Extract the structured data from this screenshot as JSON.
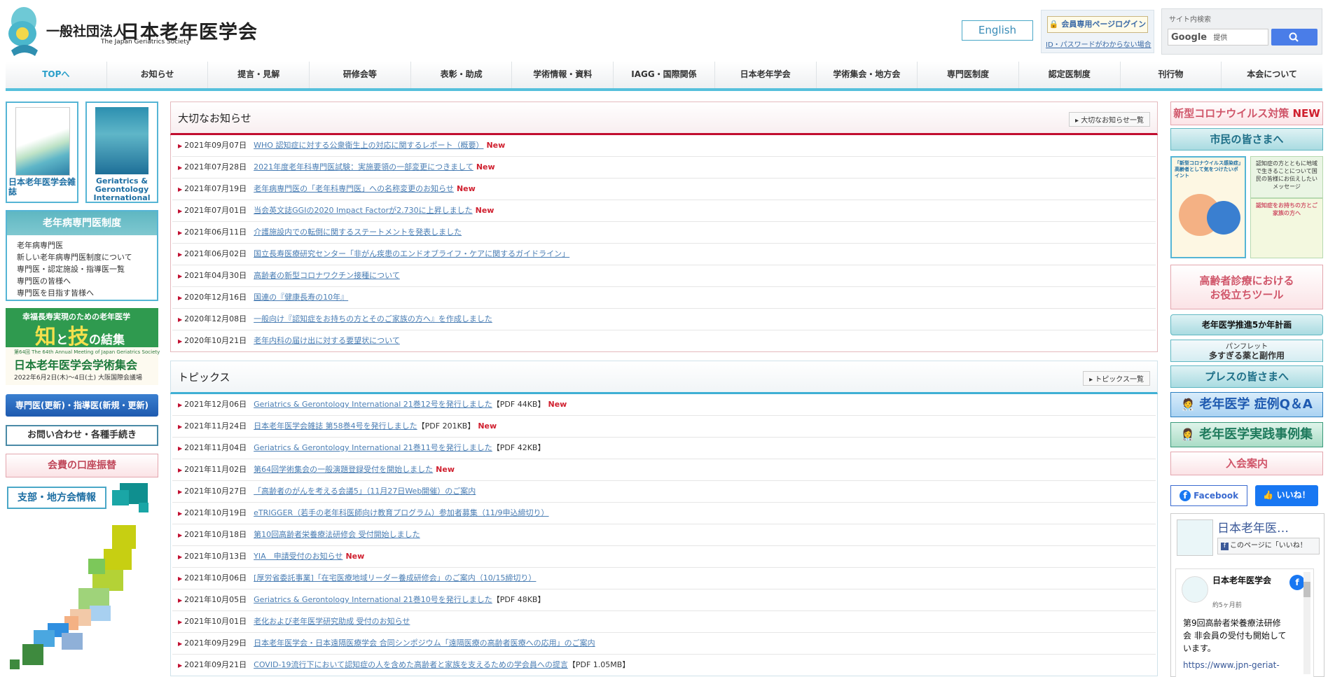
{
  "header": {
    "logo_small": "一般社団法人",
    "logo_large": "日本老年医学会",
    "logo_sub": "The Japan Geriatrics Society",
    "english": "English",
    "login": "会員専用ページログイン",
    "forgot": "ID・パスワードがわからない場合",
    "search_label": "サイト内検索",
    "search_brand": "Google",
    "search_placeholder": "提供"
  },
  "nav": [
    "TOPへ",
    "お知らせ",
    "提言・見解",
    "研修会等",
    "表彰・助成",
    "学術情報・資料",
    "IAGG・国際関係",
    "日本老年学会",
    "学術集会・地方会",
    "専門医制度",
    "認定医制度",
    "刊行物",
    "本会について"
  ],
  "left": {
    "book1": "日本老年医学会雑誌",
    "book2": "Geriatrics & Gerontology International",
    "geri_title": "老年病専門医制度",
    "geri_items": [
      "老年病専門医",
      "新しい老年病専門医制度について",
      "専門医・認定施設・指導医一覧",
      "専門医の皆様へ",
      "専門医を目指す皆様へ"
    ],
    "conf_top": "幸福長寿実現のための老年医学",
    "conf_big1": "知",
    "conf_mid": "と",
    "conf_big2": "技",
    "conf_tail": "の結集",
    "conf_sub": "第64回 The 64th Annual Meeting of Japan Geriatrics Society",
    "conf_title": "日本老年医学会学術集会",
    "conf_date": "2022年6月2日(木)～4日(土) 大阪国際会議場",
    "btn_specialist": "専門医(更新)・指導医(新規・更新)",
    "btn_contact": "お問い合わせ・各種手続き",
    "btn_fee": "会費の口座振替",
    "branch": "支部・地方会情報"
  },
  "important": {
    "title": "大切なお知らせ",
    "more": "大切なお知らせ一覧",
    "items": [
      {
        "date": "2021年09月07日",
        "text": "WHO 認知症に対する公衆衛生上の対応に関するレポート（概要）",
        "extra": "",
        "new": "New"
      },
      {
        "date": "2021年07月28日",
        "text": "2021年度老年科専門医試験：実施要領の一部変更につきまして",
        "extra": "",
        "new": "New"
      },
      {
        "date": "2021年07月19日",
        "text": "老年病専門医の「老年科専門医」への名称変更のお知らせ",
        "extra": "",
        "new": "New"
      },
      {
        "date": "2021年07月01日",
        "text": "当会英文誌GGIの2020 Impact Factorが2.730に上昇しました",
        "extra": "",
        "new": "New"
      },
      {
        "date": "2021年06月11日",
        "text": "介護施設内での転倒に関するステートメントを発表しました",
        "extra": "",
        "new": ""
      },
      {
        "date": "2021年06月02日",
        "text": "国立長寿医療研究センター「非がん疾患のエンドオブライフ・ケアに関するガイドライン」",
        "extra": "",
        "new": ""
      },
      {
        "date": "2021年04月30日",
        "text": "高齢者の新型コロナワクチン接種について",
        "extra": "",
        "new": ""
      },
      {
        "date": "2020年12月16日",
        "text": "国連の『健康長寿の10年』",
        "extra": "",
        "new": ""
      },
      {
        "date": "2020年12月08日",
        "text": "一般向け『認知症をお持ちの方とそのご家族の方へ』を作成しました",
        "extra": "",
        "new": ""
      },
      {
        "date": "2020年10月21日",
        "text": "老年内科の届け出に対する要望状について",
        "extra": "",
        "new": ""
      }
    ]
  },
  "topics": {
    "title": "トピックス",
    "more": "トピックス一覧",
    "items": [
      {
        "date": "2021年12月06日",
        "text": "Geriatrics & Gerontology International 21巻12号を発行しました",
        "extra": "【PDF 44KB】",
        "new": "New"
      },
      {
        "date": "2021年11月24日",
        "text": "日本老年医学会雑誌 第58巻4号を発行しました",
        "extra": "【PDF 201KB】",
        "new": "New"
      },
      {
        "date": "2021年11月04日",
        "text": "Geriatrics & Gerontology International 21巻11号を発行しました",
        "extra": "【PDF 42KB】",
        "new": ""
      },
      {
        "date": "2021年11月02日",
        "text": "第64回学術集会の一般演題登録受付を開始しました",
        "extra": "",
        "new": "New"
      },
      {
        "date": "2021年10月27日",
        "text": "「高齢者のがんを考える会議5」（11月27日Web開催）のご案内",
        "extra": "",
        "new": ""
      },
      {
        "date": "2021年10月19日",
        "text": "eTRIGGER（若手の老年科医師向け教育プログラム）参加者募集（11/9申込締切り）",
        "extra": "",
        "new": ""
      },
      {
        "date": "2021年10月18日",
        "text": "第10回高齢者栄養療法研修会 受付開始しました",
        "extra": "",
        "new": ""
      },
      {
        "date": "2021年10月13日",
        "text": "YIA　申請受付のお知らせ",
        "extra": "",
        "new": "New"
      },
      {
        "date": "2021年10月06日",
        "text": "[厚労省委託事業]「在宅医療地域リーダー養成研修会」のご案内（10/15締切り）",
        "extra": "",
        "new": ""
      },
      {
        "date": "2021年10月05日",
        "text": "Geriatrics & Gerontology International 21巻10号を発行しました",
        "extra": "【PDF 48KB】",
        "new": ""
      },
      {
        "date": "2021年10月01日",
        "text": "老化および老年医学研究助成 受付のお知らせ",
        "extra": "",
        "new": ""
      },
      {
        "date": "2021年09月29日",
        "text": "日本老年医学会・日本遠隔医療学会 合同シンポジウム「遠隔医療の高齢者医療への応用」のご案内",
        "extra": "",
        "new": ""
      },
      {
        "date": "2021年09月21日",
        "text": "COVID-19流行下において認知症の人を含めた高齢者と家族を支えるための学会員への提言",
        "extra": "【PDF 1.05MB】",
        "new": ""
      }
    ]
  },
  "right": {
    "covid": "新型コロナウイルス対策",
    "covid_new": "NEW",
    "citizens": "市民の皆さまへ",
    "thumb1": "「新型コロナウイルス感染症」高齢者として気をつけたいポイント",
    "thumb2": "認知症の方とともに地域で生きることについて国民の皆様にお伝えしたいメッセージ",
    "thumb3": "認知症をお持ちの方とご家族の方へ",
    "tools": "高齢者診療における\nお役立ちツール",
    "plan": "老年医学推進5か年計画",
    "pamphlet_top": "パンフレット",
    "pamphlet": "多すぎる薬と副作用",
    "press": "プレスの皆さまへ",
    "qa": "老年医学 症例Q＆A",
    "cases": "老年医学実践事例集",
    "join": "入会案内",
    "fb": "Facebook",
    "like": "いいね！",
    "fb_page": "日本老年医…",
    "fb_like_page": "このページに「いいね！",
    "post_author": "日本老年医学会",
    "post_time": "約5ヶ月前",
    "post_text": "第9回高齢者栄養療法研修会 非会員の受付も開始しています。",
    "post_link": "https://www.jpn-geriat-"
  },
  "colors": {
    "accent": "#55c0dc",
    "red": "#c10d2f",
    "link": "#4a7eb4",
    "green": "#2f9a4f"
  }
}
